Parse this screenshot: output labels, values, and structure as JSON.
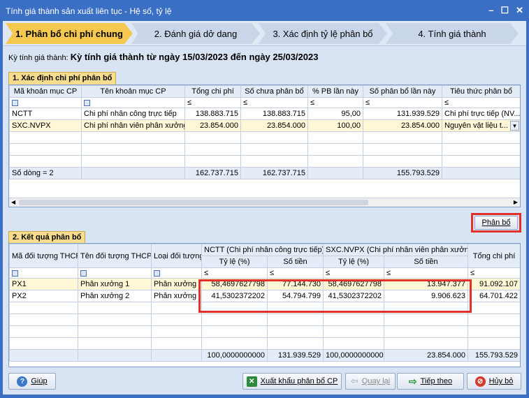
{
  "window": {
    "title": "Tính giá thành sản xuất liên tục - Hệ số, tỷ lệ",
    "min": "–",
    "max": "☐",
    "close": "✕"
  },
  "steps": [
    "1. Phân bổ chi phí chung",
    "2. Đánh giá dở dang",
    "3. Xác định tỷ lệ phân bổ",
    "4. Tính giá thành"
  ],
  "period": {
    "label": "Kỳ tính giá thành:",
    "value": "Kỳ tính giá thành từ ngày 15/03/2023 đến ngày 25/03/2023"
  },
  "section1": {
    "title": "1. Xác định chi phí phân bổ",
    "headers": [
      "Mã khoản mục CP",
      "Tên khoản mục CP",
      "Tổng chi phí",
      "Số chưa phân bổ",
      "% PB lần này",
      "Số phân bổ lần này",
      "Tiêu thức phân bổ"
    ],
    "filter_sym": "≤",
    "rows": [
      [
        "NCTT",
        "Chi phí nhân công trực tiếp",
        "138.883.715",
        "138.883.715",
        "95,00",
        "131.939.529",
        "Chi phí trực tiếp (NV..."
      ],
      [
        "SXC.NVPX",
        "Chi phí nhân viên phân xưởng",
        "23.854.000",
        "23.854.000",
        "100,00",
        "23.854.000",
        "Nguyên vật liệu t..."
      ]
    ],
    "footer": {
      "count": "Số dòng = 2",
      "tong": "162.737.715",
      "chua": "162.737.715",
      "phanbo": "155.793.529"
    }
  },
  "phanbo_button": "Phân bổ",
  "section2": {
    "title": "2. Kết quả phân bổ",
    "headers": {
      "ma": "Mã đối tượng THCP",
      "ten": "Tên đối tượng THCP",
      "loai": "Loại đối tượng",
      "g1": "NCTT (Chi phí nhân công trực tiếp)",
      "g2": "SXC.NVPX (Chi phí nhân viên phân xưởng",
      "tyle": "Tỷ lệ (%)",
      "sotien": "Số tiền",
      "tong": "Tổng chi phí"
    },
    "rows": [
      [
        "PX1",
        "Phân xưởng 1",
        "Phân xưởng",
        "58,4697627798",
        "77.144.730",
        "58,4697627798",
        "13.947.377",
        "91.092.107"
      ],
      [
        "PX2",
        "Phân xưởng 2",
        "Phân xưởng",
        "41,5302372202",
        "54.794.799",
        "41,5302372202",
        "9.906.623",
        "64.701.422"
      ]
    ],
    "footer": [
      "100,0000000000",
      "131.939.529",
      "100,0000000000",
      "23.854.000",
      "155.793.529"
    ]
  },
  "buttons": {
    "help": "Giúp",
    "export": "Xuất khẩu phân bổ CP",
    "back": "Quay lại",
    "next": "Tiếp theo",
    "cancel": "Hủy bỏ"
  }
}
